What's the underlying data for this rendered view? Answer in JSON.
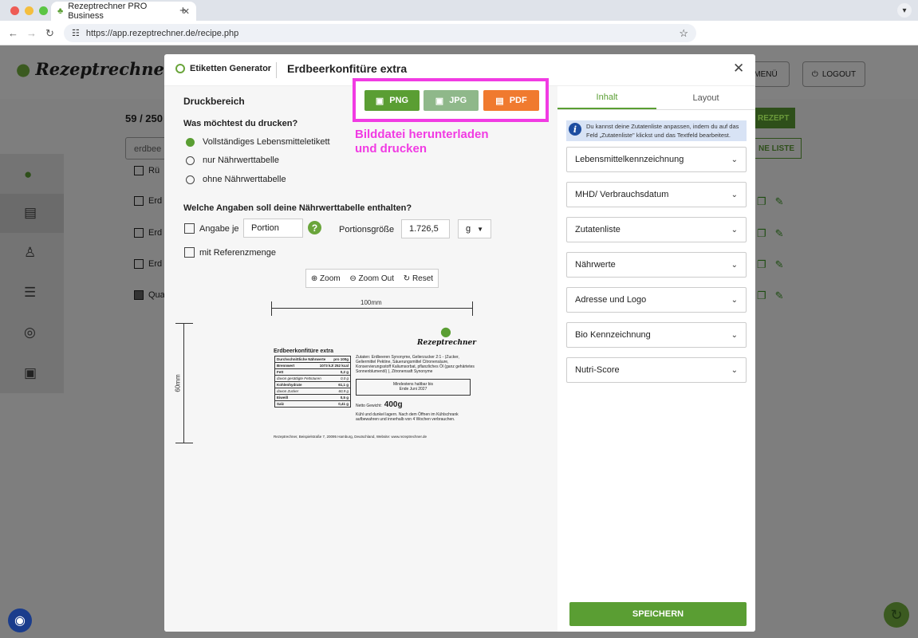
{
  "browser": {
    "tab_title": "Rezeptrechner PRO Business",
    "url": "https://app.rezeptrechner.de/recipe.php"
  },
  "app": {
    "logo_text": "Rezeptrechner",
    "menu_label": "MENÜ",
    "logout_label": "LOGOUT",
    "count_text": "59 / 250",
    "search_value": "erdbee",
    "row_labels": [
      "Rü",
      "Erd",
      "Erd",
      "Erd",
      "Qua"
    ],
    "new_recipe_label": "REZEPT",
    "list_label": "NE LISTE"
  },
  "modal": {
    "generator_label": "Etiketten Generator",
    "title": "Erdbeerkonfitüre extra",
    "print_area": "Druckbereich",
    "download": {
      "png": "PNG",
      "jpg": "JPG",
      "pdf": "PDF",
      "note_line1": "Bilddatei herunterladen",
      "note_line2": "und drucken"
    },
    "question1": "Was möchtest du drucken?",
    "print_options": [
      "Vollständiges Lebensmitteletikett",
      "nur Nährwerttabelle",
      "ohne Nährwerttabelle"
    ],
    "question2": "Welche Angaben soll deine Nährwerttabelle enthalten?",
    "angabe_je": "Angabe je",
    "portion_value": "Portion",
    "portion_size_label": "Portionsgröße",
    "portion_size_value": "1.726,5",
    "unit": "g",
    "reference_label": "mit Referenzmenge",
    "zoom_in": "Zoom",
    "zoom_out": "Zoom Out",
    "reset": "Reset",
    "width_dim": "100mm",
    "height_dim": "60mm",
    "label": {
      "title": "Erdbeerkonfitüre extra",
      "logo": "Rezeptrechner",
      "rows": [
        {
          "k": "Durchschnittliche Nährwerte",
          "v": "pro 100g"
        },
        {
          "k": "Brennwert",
          "v": "1073 kJ/ 252 kcal"
        },
        {
          "k": "Fett",
          "v": "0,2 g"
        },
        {
          "k": "davon gesättigte Fettsäuren",
          "v": "0,0 g"
        },
        {
          "k": "Kohlenhydrate",
          "v": "61,1 g"
        },
        {
          "k": "davon Zucker",
          "v": "60,9 g"
        },
        {
          "k": "Eiweiß",
          "v": "0,5 g"
        },
        {
          "k": "Salz",
          "v": "0,41 g"
        }
      ],
      "ingredients": "Zutaten: Erdbeeren Synonyme, Gelierzucker 2:1 - (Zucker, Geliermittel Pektine, Säuerungsmittel Citronensäure, Konservierungsstoff Kaliumsorbat, pflanzliches Öl (ganz gehärtetes Sonnenblumenöl) ), Zitronensaft Synonyme",
      "mhd_line1": "Mindestens haltbar bis",
      "mhd_line2": "Ende Juni 2027",
      "netto_label": "Netto Gewicht:",
      "netto_value": "400g",
      "storage": "Kühl und dunkel lagern. Nach dem Öffnen im Kühlschrank aufbewahren und innerhalb von 4 Wochen verbrauchen.",
      "address": "Rezeptrechner, Beispielstraße 7, 20095 Hamburg, Deutschland, Website: www.rezeptrechner.de"
    },
    "tabs": [
      "Inhalt",
      "Layout"
    ],
    "info_text": "Du kannst deine Zutatenliste anpassen, indem du auf das Feld „Zutatenliste\" klickst und das Textfeld bearbeitest.",
    "sections": [
      "Lebensmittelkennzeichnung",
      "MHD/ Verbrauchsdatum",
      "Zutatenliste",
      "Nährwerte",
      "Adresse und Logo",
      "Bio Kennzeichnung",
      "Nutri-Score"
    ],
    "save_label": "SPEICHERN"
  },
  "colors": {
    "green": "#5a9e33",
    "jpg": "#8fb88a",
    "pdf": "#f07a2f",
    "highlight": "#f13be3",
    "info": "#d8e3f5"
  }
}
